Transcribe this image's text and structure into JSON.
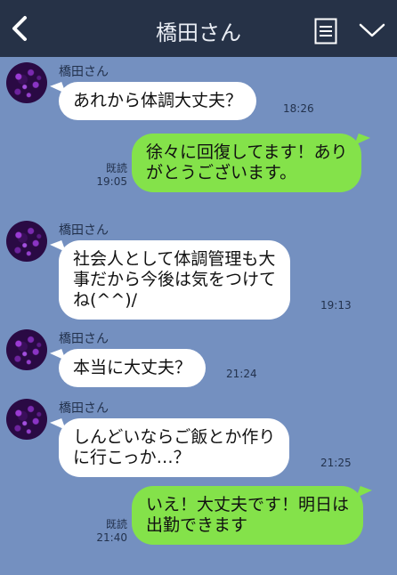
{
  "header": {
    "title": "橋田さん",
    "back_icon": "chevron-left-icon",
    "notes_icon": "notes-icon",
    "menu_icon": "chevron-down-icon"
  },
  "colors": {
    "header_bg": "#263247",
    "chat_bg": "#7490c0",
    "incoming_bubble": "#ffffff",
    "outgoing_bubble": "#84e24a"
  },
  "messages": [
    {
      "direction": "in",
      "sender": "橋田さん",
      "lines": [
        "あれから体調大丈夫？"
      ],
      "time": "18:26"
    },
    {
      "direction": "out",
      "lines": [
        "徐々に回復してます！あり",
        "がとうございます。"
      ],
      "read": "既読",
      "time": "19:05"
    },
    {
      "direction": "in",
      "sender": "橋田さん",
      "lines": [
        "社会人として体調管理も大",
        "事だから今後は気をつけて",
        "ね(^^)/"
      ],
      "time": "19:13"
    },
    {
      "direction": "in",
      "sender": "橋田さん",
      "lines": [
        "本当に大丈夫？"
      ],
      "time": "21:24"
    },
    {
      "direction": "in",
      "sender": "橋田さん",
      "lines": [
        "しんどいならご飯とか作り",
        "に行こっか…？"
      ],
      "time": "21:25"
    },
    {
      "direction": "out",
      "lines": [
        "いえ！大丈夫です！明日は",
        "出勤できます"
      ],
      "read": "既読",
      "time": "21:40"
    }
  ]
}
